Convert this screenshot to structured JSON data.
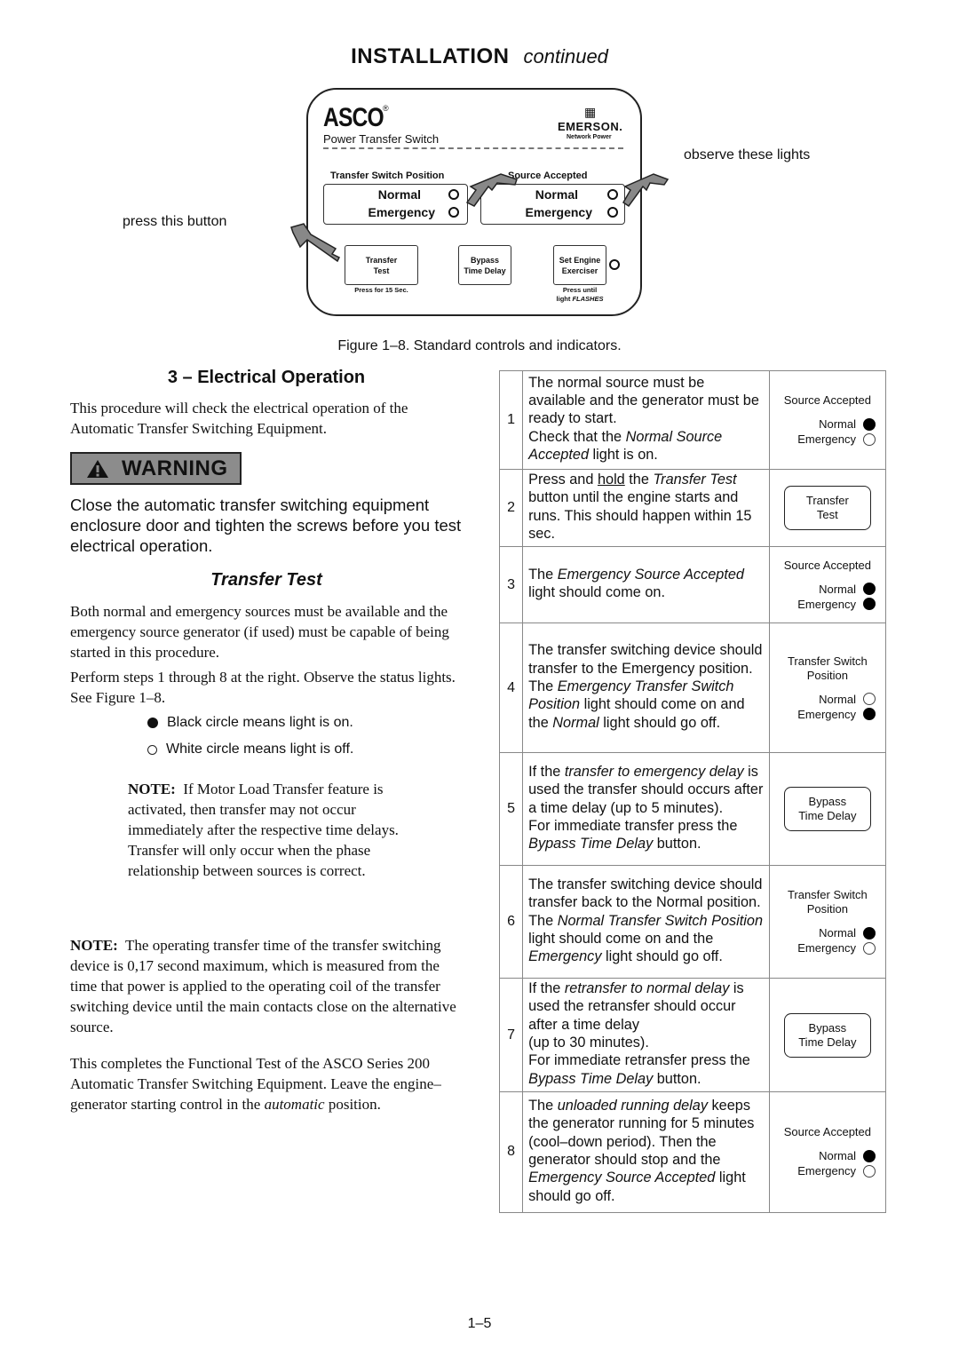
{
  "header": {
    "title": "INSTALLATION",
    "subtitle": "continued"
  },
  "figure": {
    "brand": "ASCO",
    "registered": "®",
    "product": "Power Transfer Switch",
    "partner_brand": "EMERSON.",
    "partner_sub": "Network Power",
    "groups": [
      {
        "title": "Transfer Switch Position",
        "lights": [
          {
            "label": "Normal"
          },
          {
            "label": "Emergency"
          }
        ]
      },
      {
        "title": "Source Accepted",
        "lights": [
          {
            "label": "Normal"
          },
          {
            "label": "Emergency"
          }
        ]
      }
    ],
    "buttons": [
      {
        "label_line1": "Transfer",
        "label_line2": "Test",
        "note": "Press for 15 Sec."
      },
      {
        "label_line1": "Bypass",
        "label_line2": "Time Delay",
        "note": ""
      },
      {
        "label_line1": "Set Engine",
        "label_line2": "Exerciser",
        "note_line1": "Press until",
        "note_line2": "light",
        "note_em": "FLASHES"
      }
    ],
    "callout_press": "press this button",
    "callout_observe": "observe these lights",
    "caption": "Figure 1–8. Standard controls and indicators."
  },
  "left": {
    "section_title": "3 – Electrical Operation",
    "intro": "This procedure will check the electrical operation of the Automatic Transfer Switching Equipment.",
    "warning_label": "WARNING",
    "warning_text": "Close the automatic transfer switching equipment enclosure door and tighten the screws before you test electrical operation.",
    "subsection_title": "Transfer Test",
    "para1": "Both normal and emergency sources must be available and the emergency source generator (if used) must be capable of being started in this procedure.",
    "para2": "Perform steps 1 through 8 at the right.  Observe the status lights.  See Figure 1–8.",
    "legend_on": "Black circle means light is on.",
    "legend_off": "White circle means light is off.",
    "note1_label": "NOTE:",
    "note1_text": "If Motor Load Transfer feature is activated, then transfer may not occur immediately after the respective time delays.  Transfer will only occur when the phase relationship between sources is correct.",
    "note2_label": "NOTE:",
    "note2_text": "The operating transfer time of the transfer switching device is 0,17 second maximum, which is measured from the time that power is applied to the operating coil of the transfer switching device until the main contacts close on the alternative source.",
    "closing_text": "This completes the Functional Test of the ASCO Series 200 Automatic Transfer Switching Equipment. Leave the engine–generator starting control in the",
    "closing_em": "automatic",
    "closing_tail": "position."
  },
  "steps": [
    {
      "num": "1",
      "indicator": {
        "title": "Source Accepted",
        "normal": "Normal",
        "emergency": "Emergency",
        "normal_on": true,
        "emergency_on": false
      },
      "t": [
        "The normal source must be available and the generator must be ready to start.",
        "Check that the ",
        "Normal Source Accepted",
        " light is on."
      ]
    },
    {
      "num": "2",
      "button": {
        "line1": "Transfer",
        "line2": "Test"
      },
      "t": [
        "Press and ",
        "hold",
        " the ",
        "Transfer Test",
        " button until the engine starts and runs. This should happen within 15 sec."
      ]
    },
    {
      "num": "3",
      "indicator": {
        "title": "Source Accepted",
        "normal": "Normal",
        "emergency": "Emergency",
        "normal_on": true,
        "emergency_on": true
      },
      "t": [
        "The ",
        "Emergency Source Accepted",
        " light should come on."
      ]
    },
    {
      "num": "4",
      "indicator": {
        "title": "Transfer Switch Position",
        "normal": "Normal",
        "emergency": "Emergency",
        "normal_on": false,
        "emergency_on": true
      },
      "t": [
        "The transfer switching device should transfer to the Emergency position. The ",
        "Emergency Transfer Switch Position",
        " light should come on and the ",
        "Normal",
        " light should go off."
      ]
    },
    {
      "num": "5",
      "button": {
        "line1": "Bypass",
        "line2": "Time Delay"
      },
      "t": [
        "If the ",
        "transfer to emergency delay",
        " is used the transfer should occurs after a time delay (up to 5 minutes).",
        "For immediate transfer press the ",
        "Bypass Time Delay",
        " button."
      ]
    },
    {
      "num": "6",
      "indicator": {
        "title": "Transfer Switch Position",
        "normal": "Normal",
        "emergency": "Emergency",
        "normal_on": true,
        "emergency_on": false
      },
      "t": [
        "The transfer switching device should transfer back to the Normal position. The ",
        "Normal Transfer Switch Position",
        " light should come on and the ",
        "Emergency",
        " light should go off."
      ]
    },
    {
      "num": "7",
      "button": {
        "line1": "Bypass",
        "line2": "Time Delay"
      },
      "t": [
        "If the ",
        "retransfer to normal delay",
        " is used the retransfer should occur after a time delay",
        "(up to 30 minutes).",
        "For immediate retransfer press the ",
        "Bypass Time Delay",
        " button."
      ]
    },
    {
      "num": "8",
      "indicator": {
        "title": "Source Accepted",
        "normal": "Normal",
        "emergency": "Emergency",
        "normal_on": true,
        "emergency_on": false
      },
      "t": [
        "The ",
        "unloaded running delay",
        " keeps the generator running for 5 minutes (cool–down period). Then the generator should stop and the ",
        "Emergency Source Accepted",
        " light should go off."
      ]
    }
  ],
  "footer": {
    "page_number": "1–5"
  }
}
